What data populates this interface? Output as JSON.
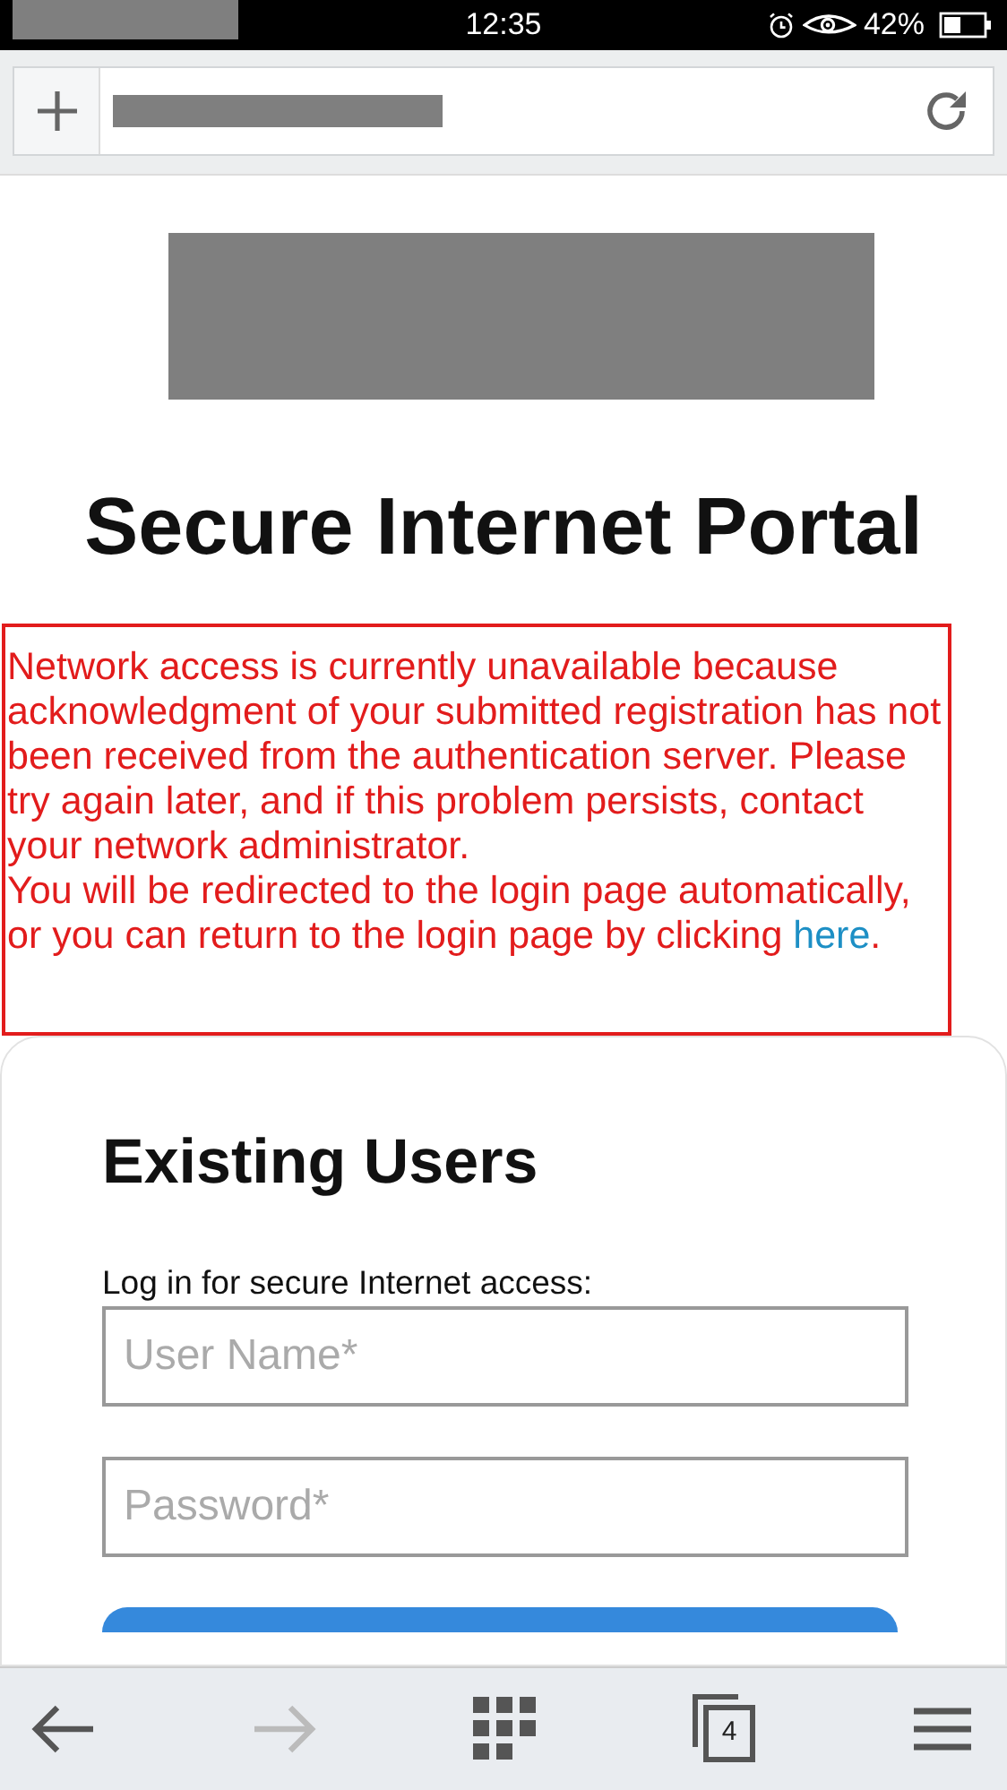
{
  "status_bar": {
    "time": "12:35",
    "battery": "42%"
  },
  "page": {
    "title": "Secure Internet Portal",
    "notice": {
      "text": "Network access is currently unavailable because acknowledgment of your submitted registration has not been received from the authentication server. Please try again later, and if this problem persists, contact your network administrator.",
      "redirect_before": "You will be redirected to the login page automatically, or you can return to the login page by clicking ",
      "link": "here",
      "redirect_after": "."
    },
    "login": {
      "heading": "Existing Users",
      "label": "Log in for secure Internet access:",
      "fields": [
        {
          "placeholder": "User Name*"
        },
        {
          "placeholder": "Password*"
        }
      ]
    }
  },
  "toolbar": {
    "back": {
      "disabled": false
    },
    "forward": {
      "disabled": true
    },
    "tab_count": "4"
  }
}
